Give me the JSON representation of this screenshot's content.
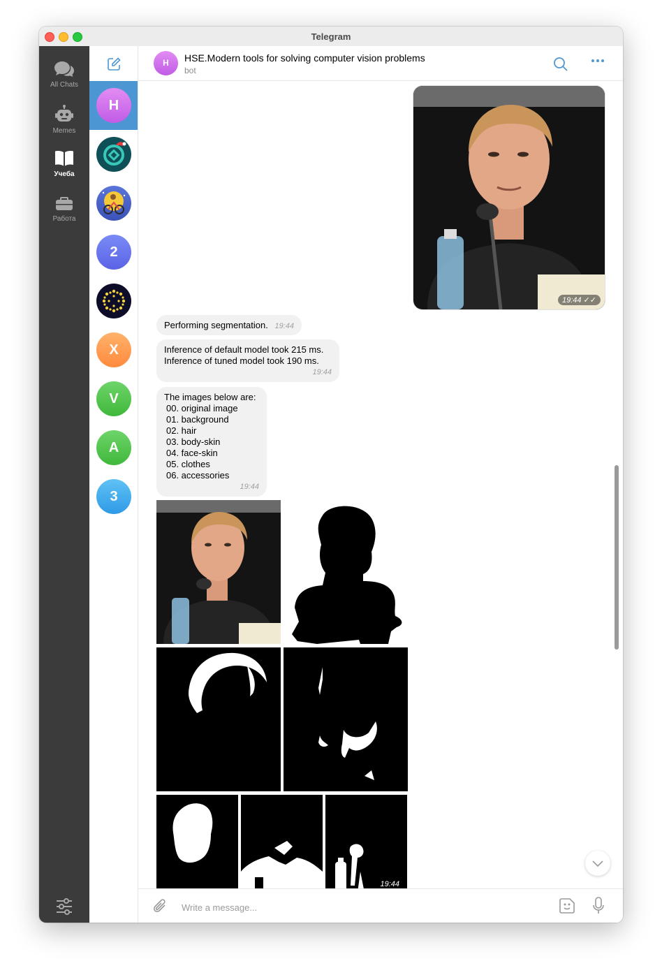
{
  "window": {
    "title": "Telegram"
  },
  "folders": [
    {
      "label": "All Chats",
      "icon": "chat-bubbles-icon"
    },
    {
      "label": "Memes",
      "icon": "robot-icon"
    },
    {
      "label": "Учеба",
      "icon": "book-icon",
      "active": true
    },
    {
      "label": "Работа",
      "icon": "briefcase-icon"
    }
  ],
  "chats": [
    {
      "initial": "H",
      "color_top": "#e38cf3",
      "color_bottom": "#c05ce6",
      "selected": true
    },
    {
      "initial": "",
      "icon": "logo-ring-icon",
      "color_top": "#0f4f57",
      "color_bottom": "#0f4f57"
    },
    {
      "initial": "",
      "icon": "illustration-icon",
      "color_top": "#5a74d9",
      "color_bottom": "#f1b83b"
    },
    {
      "initial": "2",
      "color_top": "#7a8bf5",
      "color_bottom": "#5b63e6"
    },
    {
      "initial": "",
      "icon": "dotted-circle-icon",
      "color_top": "#0d0d2a",
      "color_bottom": "#0d0d2a"
    },
    {
      "initial": "X",
      "color_top": "#ffb26b",
      "color_bottom": "#ff8a3c"
    },
    {
      "initial": "V",
      "color_top": "#6ed46a",
      "color_bottom": "#3fb83a"
    },
    {
      "initial": "A",
      "color_top": "#6ed46a",
      "color_bottom": "#3fb83a"
    },
    {
      "initial": "3",
      "color_top": "#5fc2f5",
      "color_bottom": "#2f9ae6"
    }
  ],
  "header": {
    "avatar_initial": "H",
    "title": "HSE.Modern tools for solving computer vision problems",
    "subtitle": "bot"
  },
  "messages": {
    "photo_time": "19:44",
    "seg_text": "Performing segmentation.",
    "seg_time": "19:44",
    "inference_line1": "Inference of default model took 215 ms.",
    "inference_line2": "Inference of tuned model took 190 ms.",
    "inference_time": "19:44",
    "list_heading": "The images below are:",
    "list_items": [
      "00. original image",
      "01. background",
      "02. hair",
      "03. body-skin",
      "04. face-skin",
      "05. clothes",
      "06. accessories"
    ],
    "list_time": "19:44",
    "album_time": "19:44"
  },
  "composer": {
    "placeholder": "Write a message..."
  },
  "colors": {
    "accent": "#4c96d3",
    "bubble": "#f1f1f1",
    "sidebar": "#3b3b3b"
  }
}
